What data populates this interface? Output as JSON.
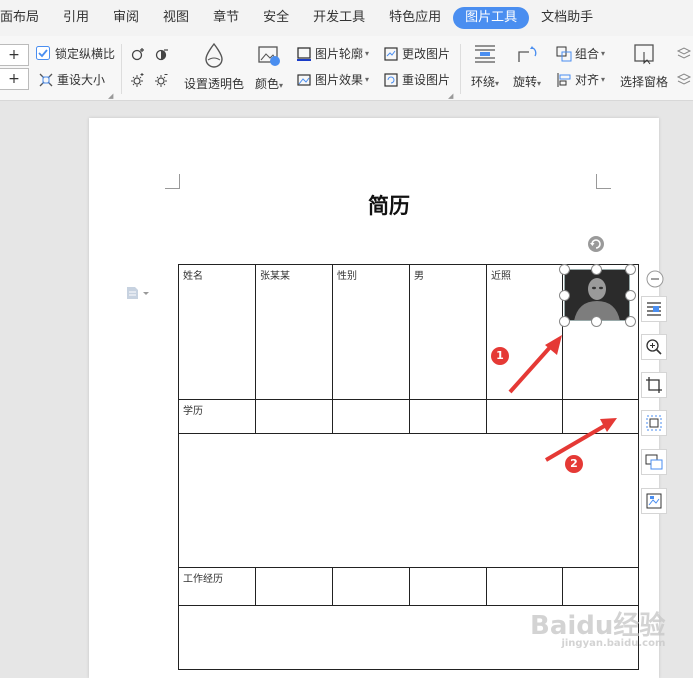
{
  "menubar": {
    "items": [
      {
        "label": "面布局",
        "active": false
      },
      {
        "label": "引用",
        "active": false
      },
      {
        "label": "审阅",
        "active": false
      },
      {
        "label": "视图",
        "active": false
      },
      {
        "label": "章节",
        "active": false
      },
      {
        "label": "安全",
        "active": false
      },
      {
        "label": "开发工具",
        "active": false
      },
      {
        "label": "特色应用",
        "active": false
      },
      {
        "label": "图片工具",
        "active": true
      },
      {
        "label": "文档助手",
        "active": false
      }
    ]
  },
  "toolbar": {
    "lock_ratio_label": "锁定纵横比",
    "reset_size_label": "重设大小",
    "transparent_label": "设置透明色",
    "color_label": "颜色",
    "outline_label": "图片轮廓",
    "effect_label": "图片效果",
    "change_pic_label": "更改图片",
    "reset_pic_label": "重设图片",
    "wrap_label": "环绕",
    "rotate_label": "旋转",
    "group_label": "组合",
    "align_label": "对齐",
    "selection_pane_label": "选择窗格",
    "plus": "+"
  },
  "document": {
    "title": "简历",
    "table": {
      "row1": [
        "姓名",
        "张某某",
        "性别",
        "男",
        "近照"
      ],
      "education": "学历",
      "work": "工作经历"
    }
  },
  "annotations": {
    "marker1": "1",
    "marker2": "2"
  },
  "watermark": {
    "text": "Baidu经验",
    "sub": "jingyan.baidu.com"
  },
  "colors": {
    "accent": "#4a8ef0",
    "marker": "#e53935"
  }
}
